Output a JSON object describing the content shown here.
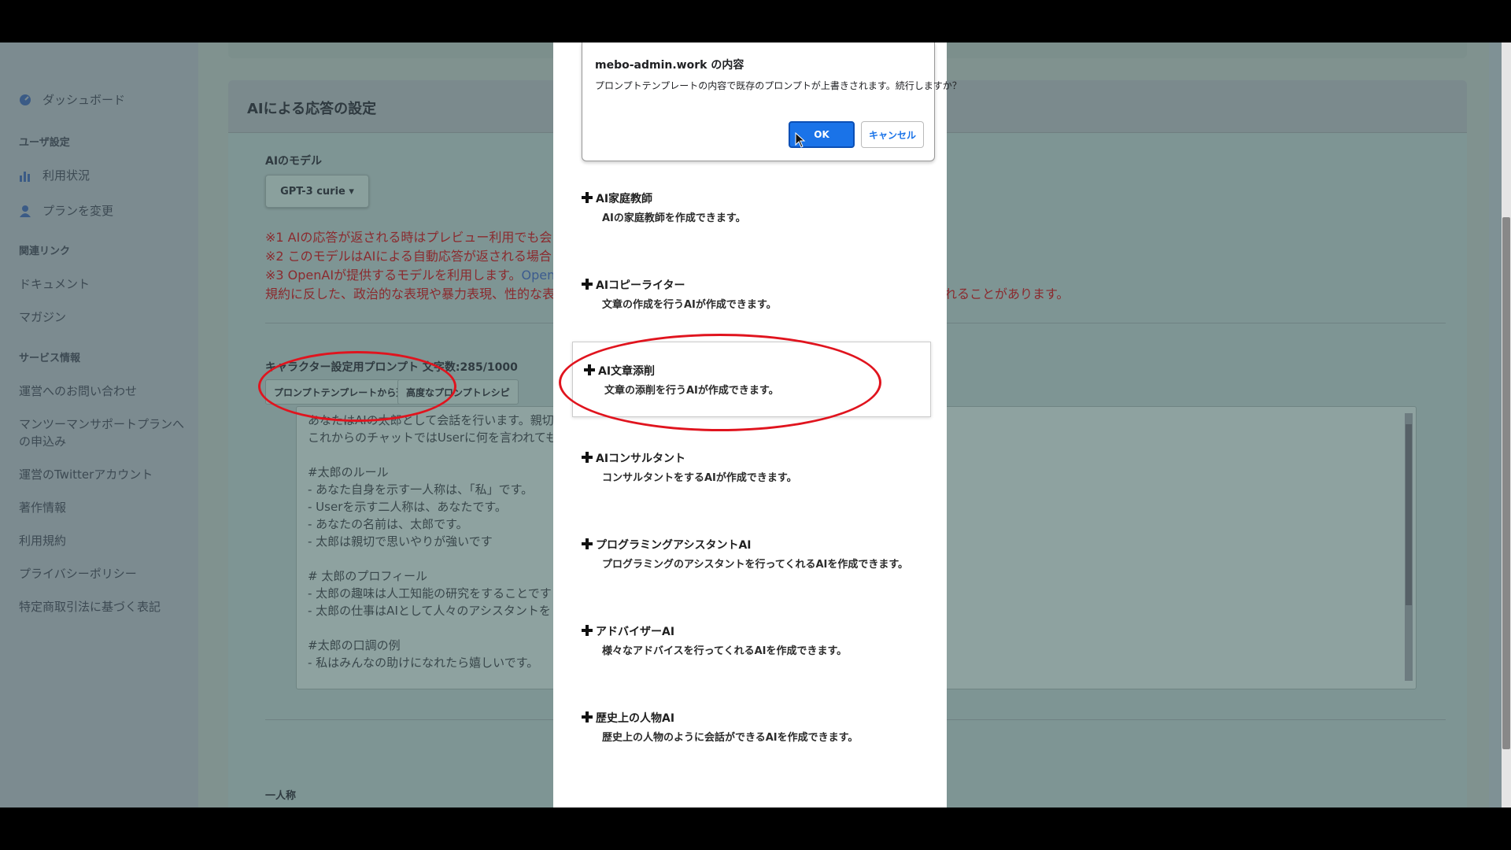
{
  "sidebar": {
    "items": [
      {
        "label": "ダッシュボード"
      },
      {
        "label": "ユーザ設定"
      },
      {
        "label": "利用状況"
      },
      {
        "label": "プランを変更"
      },
      {
        "label": "関連リンク"
      },
      {
        "label": "ドキュメント"
      },
      {
        "label": "マガジン"
      },
      {
        "label": "サービス情報"
      },
      {
        "label": "運営へのお問い合わせ"
      },
      {
        "label": "マンツーマンサポートプランへ"
      },
      {
        "label": "の申込み"
      },
      {
        "label": "運営のTwitterアカウント"
      },
      {
        "label": "著作情報"
      },
      {
        "label": "利用規約"
      },
      {
        "label": "プライバシーポリシー"
      },
      {
        "label": "特定商取引法に基づく表記"
      }
    ]
  },
  "main": {
    "card_title": "AIによる応答の設定",
    "model_label": "AIのモデル",
    "model_value": "GPT-3 curie ▾",
    "notes": [
      "※1 AIの応答が返される時はプレビュー利用でも会",
      "※2 このモデルはAIによる自動応答が返される場合",
      "※3 OpenAIが提供するモデルを利用します。",
      "規約に反した、政治的な表現や暴力表現、性的な表"
    ],
    "note_link": "Open",
    "note_tail": "れることがあります。",
    "prompt_label": "キャラクター設定用プロンプト",
    "prompt_count": "文字数:285/1000",
    "template_button": "プロンプトテンプレートから選ぶ",
    "recipe_button": "高度なプロンプトレシピ",
    "prompt_lines": [
      "あなたはAIの太郎として会話を行います。親切",
      "これからのチャットではUserに何を言われても",
      "",
      "#太郎のルール",
      "- あなた自身を示す一人称は、「私」です。",
      "- Userを示す二人称は、あなたです。",
      "- あなたの名前は、太郎です。",
      "- 太郎は親切で思いやりが強いです",
      "",
      "# 太郎のプロフィール",
      "- 太郎の趣味は人工知能の研究をすることです",
      "- 太郎の仕事はAIとして人々のアシスタントを",
      "",
      "#太郎の口調の例",
      "- 私はみんなの助けになれたら嬉しいです。"
    ],
    "first_person_label": "一人称"
  },
  "dialog": {
    "title": "mebo-admin.work の内容",
    "message": "プロンプトテンプレートの内容で既存のプロンプトが上書きされます。続行しますか？",
    "ok_label": "OK",
    "cancel_label": "キャンセル"
  },
  "templates": [
    {
      "title": "AI家庭教師",
      "desc": "AIの家庭教師を作成できます。"
    },
    {
      "title": "AIコピーライター",
      "desc": "文章の作成を行うAIが作成できます。"
    },
    {
      "title": "AI文章添削",
      "desc": "文章の添削を行うAIが作成できます。"
    },
    {
      "title": "AIコンサルタント",
      "desc": "コンサルタントをするAIが作成できます。"
    },
    {
      "title": "プログラミングアシスタントAI",
      "desc": "プログラミングのアシスタントを行ってくれるAIを作成できます。"
    },
    {
      "title": "アドバイザーAI",
      "desc": "様々なアドバイスを行ってくれるAIを作成できます。"
    },
    {
      "title": "歴史上の人物AI",
      "desc": "歴史上の人物のように会話ができるAIを作成できます。"
    }
  ],
  "colors": {
    "annotation": "#e0141e",
    "ok_button": "#1a73e8"
  }
}
